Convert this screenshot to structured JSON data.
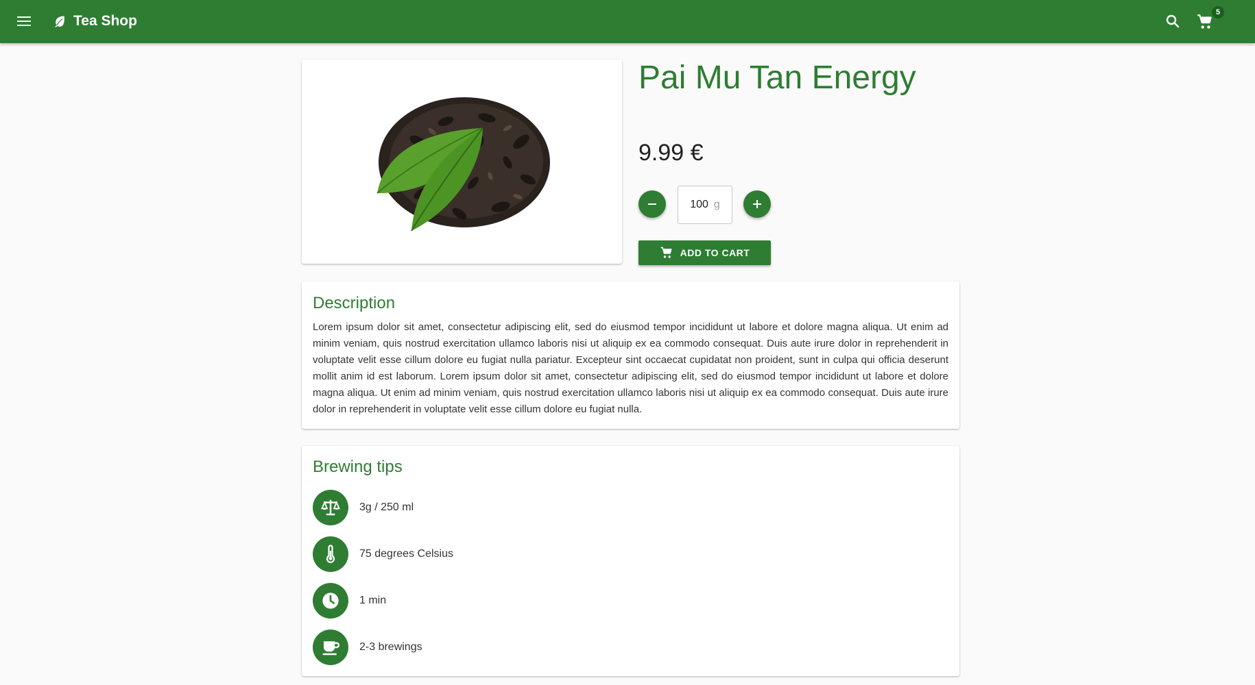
{
  "appbar": {
    "title": "Tea Shop",
    "cart_count": "5",
    "icons": [
      "menu-icon",
      "leaf-icon",
      "search-icon",
      "cart-icon"
    ]
  },
  "product": {
    "name": "Pai Mu Tan Energy",
    "price": "9.99 €",
    "quantity": {
      "value": "100",
      "unit": "g"
    },
    "add_to_cart_label": "ADD TO CART"
  },
  "description": {
    "heading": "Description",
    "text": "Lorem ipsum dolor sit amet, consectetur adipiscing elit, sed do eiusmod tempor incididunt ut labore et dolore magna aliqua. Ut enim ad minim veniam, quis nostrud exercitation ullamco laboris nisi ut aliquip ex ea commodo consequat. Duis aute irure dolor in reprehenderit in voluptate velit esse cillum dolore eu fugiat nulla pariatur. Excepteur sint occaecat cupidatat non proident, sunt in culpa qui officia deserunt mollit anim id est laborum. Lorem ipsum dolor sit amet, consectetur adipiscing elit, sed do eiusmod tempor incididunt ut labore et dolore magna aliqua. Ut enim ad minim veniam, quis nostrud exercitation ullamco laboris nisi ut aliquip ex ea commodo consequat. Duis aute irure dolor in reprehenderit in voluptate velit esse cillum dolore eu fugiat nulla."
  },
  "brewing": {
    "heading": "Brewing tips",
    "tips": [
      {
        "icon": "scale-icon",
        "text": "3g / 250 ml"
      },
      {
        "icon": "thermometer-icon",
        "text": "75 degrees Celsius"
      },
      {
        "icon": "clock-icon",
        "text": "1 min"
      },
      {
        "icon": "cup-icon",
        "text": "2-3 brewings"
      }
    ]
  },
  "colors": {
    "primary": "#2e7d32",
    "background": "#fafafa"
  }
}
